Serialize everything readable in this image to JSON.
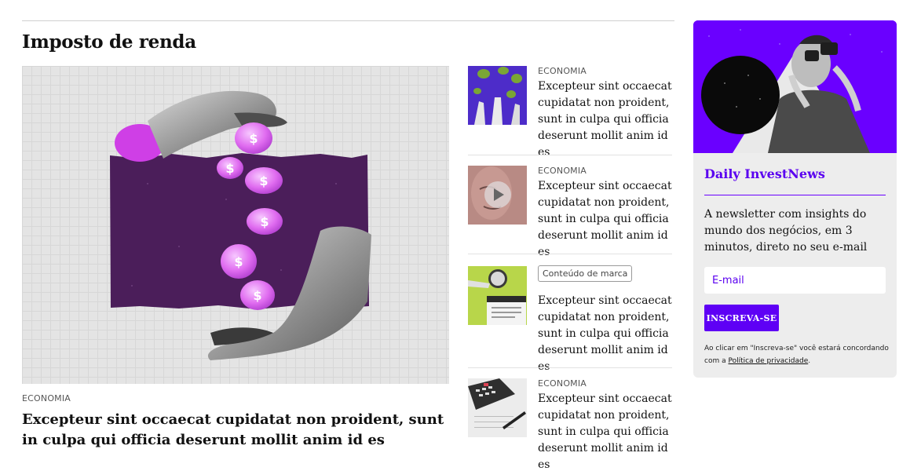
{
  "section": {
    "title": "Imposto de renda"
  },
  "feature": {
    "kicker": "ECONOMIA",
    "headline": "Excepteur sint occaecat cupidatat non proident, sunt in culpa qui officia deserunt mollit anim id es",
    "image_icon": "hands-coins-illustration"
  },
  "list": [
    {
      "kicker": "ECONOMIA",
      "title": "Excepteur sint occaecat cupidatat non proident, sunt in culpa qui officia deserunt mollit anim id es",
      "thumb_icon": "hands-coins-thumbnail"
    },
    {
      "kicker": "ECONOMIA",
      "title": "Excepteur sint occaecat cupidatat non proident, sunt in culpa qui officia deserunt mollit anim id es",
      "thumb_icon": "video-play-thumbnail"
    },
    {
      "tag": "Conteúdo de marca",
      "title": "Excepteur sint occaecat cupidatat non proident, sunt in culpa qui officia deserunt mollit anim id es",
      "thumb_icon": "magnifier-document-thumbnail"
    },
    {
      "kicker": "ECONOMIA",
      "title": "Excepteur sint occaecat cupidatat non proident, sunt in culpa qui officia deserunt mollit anim id es",
      "thumb_icon": "calculator-paperwork-thumbnail"
    }
  ],
  "newsletter": {
    "title": "Daily InvestNews",
    "description": "A newsletter com insights do mundo dos negócios, em 3 minutos, direto no seu e-mail",
    "email_placeholder": "E-mail",
    "button_label": "INSCREVA-SE",
    "legal_prefix": "Ao clicar em \"Inscreva-se\" você estará concordando com a ",
    "legal_link": "Política de privacidade",
    "legal_suffix": ".",
    "image_icon": "man-binoculars-illustration",
    "accent_color": "#6a00ff"
  }
}
